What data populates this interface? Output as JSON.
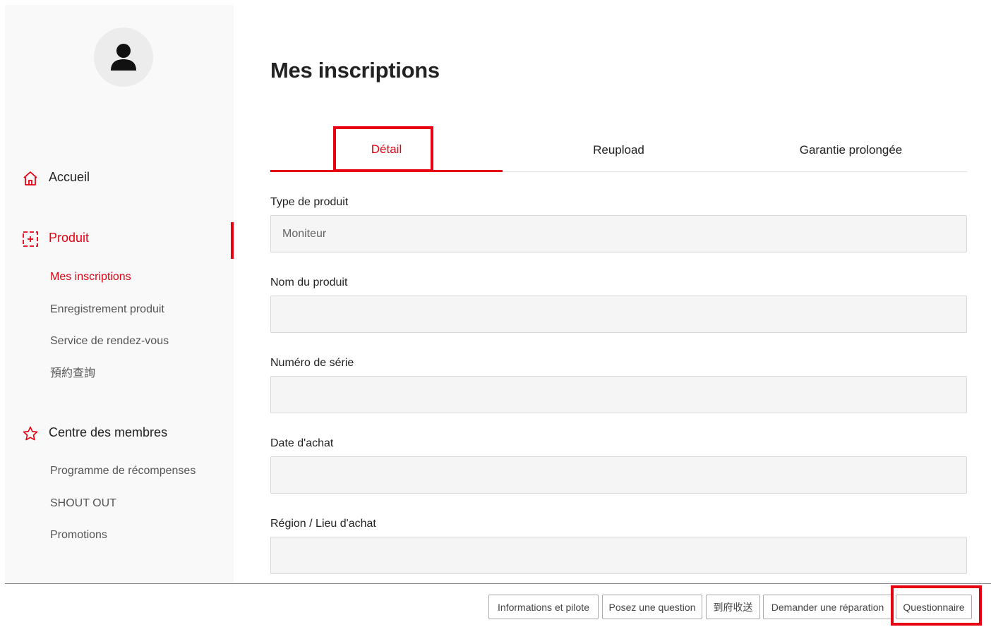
{
  "sidebar": {
    "home_label": "Accueil",
    "product_label": "Produit",
    "product_items": [
      {
        "label": "Mes inscriptions"
      },
      {
        "label": "Enregistrement produit"
      },
      {
        "label": "Service de rendez-vous"
      },
      {
        "label": "預約查詢"
      }
    ],
    "member_label": "Centre des membres",
    "member_items": [
      {
        "label": "Programme de récompenses"
      },
      {
        "label": "SHOUT OUT"
      },
      {
        "label": "Promotions"
      }
    ]
  },
  "main": {
    "title": "Mes inscriptions",
    "tabs": [
      {
        "label": "Détail"
      },
      {
        "label": "Reupload"
      },
      {
        "label": "Garantie prolongée"
      }
    ],
    "fields": [
      {
        "label": "Type de produit",
        "value": "Moniteur"
      },
      {
        "label": "Nom du produit",
        "value": ""
      },
      {
        "label": "Numéro de série",
        "value": ""
      },
      {
        "label": "Date d'achat",
        "value": ""
      },
      {
        "label": "Région / Lieu d'achat",
        "value": ""
      }
    ]
  },
  "footer": {
    "buttons": [
      {
        "label": "Informations et pilote"
      },
      {
        "label": "Posez une question"
      },
      {
        "label": "到府收送"
      },
      {
        "label": "Demander une réparation"
      },
      {
        "label": "Questionnaire"
      }
    ]
  },
  "colors": {
    "accent": "#e60012",
    "sidebar_bg": "#f9f9f9",
    "input_bg": "#f5f5f5"
  },
  "icons": {
    "avatar": "user-icon",
    "home": "home-icon",
    "product": "product-plus-icon",
    "member": "star-icon"
  }
}
